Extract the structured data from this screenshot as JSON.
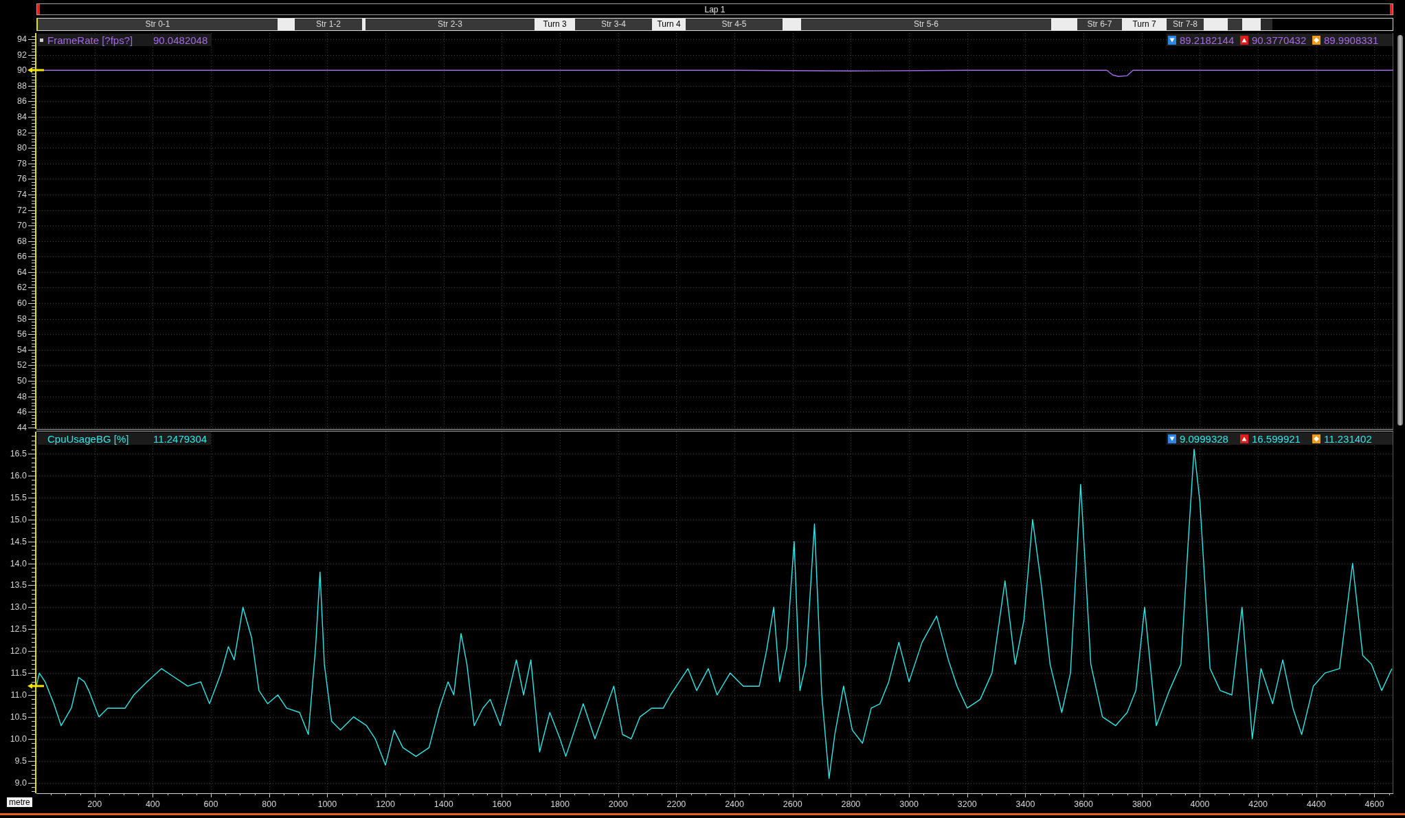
{
  "lap_bar": {
    "label": "Lap 1"
  },
  "segments": [
    {
      "label": "Str 0-1",
      "color": "#383838"
    },
    {
      "color": "#ececec"
    },
    {
      "label": "Str 1-2",
      "color": "#383838"
    },
    {
      "color": "#ececec"
    },
    {
      "label": "Str 2-3",
      "color": "#383838"
    },
    {
      "label": "Turn 3",
      "color": "#ececec"
    },
    {
      "label": "Str 3-4",
      "color": "#383838"
    },
    {
      "label": "Turn 4",
      "color": "#ececec"
    },
    {
      "label": "Str 4-5",
      "color": "#383838"
    },
    {
      "color": "#ececec"
    },
    {
      "label": "Str 5-6",
      "color": "#383838"
    },
    {
      "color": "#ececec"
    },
    {
      "label": "Str 6-7",
      "color": "#383838"
    },
    {
      "label": "Turn 7",
      "color": "#ececec"
    },
    {
      "label": "Str 7-8",
      "color": "#383838"
    },
    {
      "color": "#ececec"
    },
    {
      "color": "#383838"
    },
    {
      "color": "#ececec"
    },
    {
      "color": "#2a2a2a"
    }
  ],
  "charts": [
    {
      "legend": {
        "selected": true,
        "cursor_value": "90.0482048",
        "stats": [
          {
            "kind": "min",
            "value": "89.2182144"
          },
          {
            "kind": "max",
            "value": "90.3770432"
          },
          {
            "kind": "average",
            "value": "89.9908331"
          }
        ]
      },
      "chart_data": {
        "type": "line",
        "grid": true,
        "x": [
          0,
          400,
          800,
          1200,
          1600,
          2000,
          2400,
          2800,
          3200,
          3600,
          3680,
          3700,
          3720,
          3750,
          3770,
          3800,
          4200,
          4665
        ],
        "series": [
          {
            "name": "FrameRate [?fps?]",
            "color": "#a46ae6",
            "values": [
              90.0,
              90.0,
              90.0,
              90.0,
              90.0,
              90.0,
              90.0,
              89.9,
              90.0,
              90.0,
              90.0,
              89.4,
              89.2,
              89.3,
              90.0,
              90.0,
              90.0,
              90.0
            ]
          }
        ],
        "xlim": [
          0,
          4665
        ],
        "ylim": [
          43.8,
          94.8
        ],
        "yticks": [
          94,
          92,
          90,
          88,
          86,
          84,
          82,
          80,
          78,
          76,
          74,
          72,
          70,
          68,
          66,
          64,
          62,
          60,
          58,
          56,
          54,
          52,
          50,
          48,
          46,
          44
        ]
      }
    },
    {
      "legend": {
        "selected": false,
        "cursor_value": "11.2479304",
        "stats": [
          {
            "kind": "min",
            "value": "9.0999328"
          },
          {
            "kind": "max",
            "value": "16.599921"
          },
          {
            "kind": "average",
            "value": "11.231402"
          }
        ]
      },
      "chart_data": {
        "type": "line",
        "grid": true,
        "xlabel": "metre",
        "x": [
          0,
          10,
          30,
          60,
          85,
          120,
          145,
          165,
          180,
          215,
          245,
          305,
          335,
          380,
          430,
          475,
          520,
          565,
          595,
          635,
          660,
          680,
          710,
          740,
          765,
          795,
          830,
          860,
          905,
          935,
          960,
          975,
          990,
          1015,
          1045,
          1090,
          1135,
          1165,
          1200,
          1230,
          1260,
          1305,
          1350,
          1385,
          1415,
          1435,
          1460,
          1480,
          1505,
          1535,
          1560,
          1595,
          1625,
          1650,
          1675,
          1700,
          1730,
          1765,
          1800,
          1820,
          1860,
          1880,
          1920,
          1985,
          2015,
          2045,
          2075,
          2115,
          2155,
          2180,
          2210,
          2240,
          2270,
          2310,
          2340,
          2385,
          2430,
          2485,
          2510,
          2535,
          2555,
          2580,
          2605,
          2625,
          2645,
          2675,
          2700,
          2725,
          2745,
          2775,
          2805,
          2840,
          2870,
          2900,
          2930,
          2965,
          3000,
          3045,
          3095,
          3135,
          3165,
          3200,
          3245,
          3285,
          3330,
          3365,
          3395,
          3425,
          3455,
          3485,
          3525,
          3555,
          3590,
          3625,
          3665,
          3710,
          3750,
          3780,
          3810,
          3850,
          3895,
          3935,
          3960,
          3980,
          4000,
          4035,
          4070,
          4110,
          4145,
          4180,
          4210,
          4250,
          4285,
          4320,
          4350,
          4390,
          4430,
          4480,
          4525,
          4560,
          4590,
          4625,
          4660
        ],
        "series": [
          {
            "name": "CpuUsageBG [%]",
            "color": "#2ee8e8",
            "values": [
              11.2,
              11.5,
              11.3,
              10.8,
              10.3,
              10.7,
              11.4,
              11.3,
              11.1,
              10.5,
              10.7,
              10.7,
              11.0,
              11.3,
              11.6,
              11.4,
              11.2,
              11.3,
              10.8,
              11.5,
              12.1,
              11.8,
              13.0,
              12.3,
              11.1,
              10.8,
              11.0,
              10.7,
              10.6,
              10.1,
              12.1,
              13.8,
              11.7,
              10.4,
              10.2,
              10.5,
              10.3,
              10.0,
              9.4,
              10.2,
              9.8,
              9.6,
              9.8,
              10.7,
              11.3,
              11.0,
              12.4,
              11.7,
              10.3,
              10.7,
              10.9,
              10.3,
              11.1,
              11.8,
              11.0,
              11.8,
              9.7,
              10.6,
              10.0,
              9.6,
              10.4,
              10.8,
              10.0,
              11.2,
              10.1,
              10.0,
              10.5,
              10.7,
              10.7,
              11.0,
              11.3,
              11.6,
              11.1,
              11.6,
              11.0,
              11.5,
              11.2,
              11.2,
              12.0,
              13.0,
              11.3,
              12.1,
              14.5,
              11.1,
              11.7,
              14.9,
              11.0,
              9.1,
              10.1,
              11.2,
              10.2,
              9.9,
              10.7,
              10.8,
              11.3,
              12.2,
              11.3,
              12.2,
              12.8,
              11.8,
              11.2,
              10.7,
              10.9,
              11.5,
              13.6,
              11.7,
              12.7,
              15.0,
              13.5,
              11.7,
              10.6,
              11.5,
              15.8,
              11.7,
              10.5,
              10.3,
              10.6,
              11.1,
              13.0,
              10.3,
              11.1,
              11.7,
              14.5,
              16.6,
              15.4,
              11.6,
              11.1,
              11.0,
              13.0,
              10.0,
              11.6,
              10.8,
              11.8,
              10.7,
              10.1,
              11.2,
              11.5,
              11.6,
              14.0,
              11.9,
              11.7,
              11.1,
              11.6
            ]
          }
        ],
        "xlim": [
          0,
          4665
        ],
        "ylim": [
          8.76,
          17.0
        ],
        "xticks": [
          200,
          400,
          600,
          800,
          1000,
          1200,
          1400,
          1600,
          1800,
          2000,
          2200,
          2400,
          2600,
          2800,
          3000,
          3200,
          3400,
          3600,
          3800,
          4000,
          4200,
          4400,
          4600
        ],
        "yticks": [
          16.5,
          {
            "value": 16,
            "label": "16.0"
          },
          15.5,
          {
            "value": 15,
            "label": "15.0"
          },
          14.5,
          {
            "value": 14,
            "label": "14.0"
          },
          13.5,
          {
            "value": 13,
            "label": "13.0"
          },
          12.5,
          {
            "value": 12,
            "label": "12.0"
          },
          11.5,
          {
            "value": 11,
            "label": "11.0"
          },
          10.5,
          {
            "value": 10,
            "label": "10.0"
          },
          9.5,
          {
            "value": 9,
            "label": "9.0"
          }
        ]
      }
    }
  ]
}
